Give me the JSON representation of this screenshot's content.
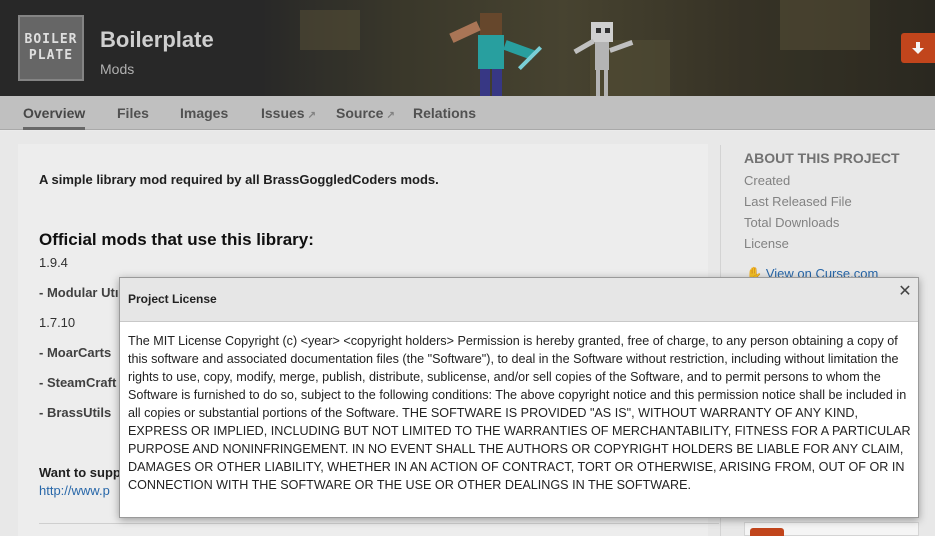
{
  "project": {
    "logo_line1": "BOILER",
    "logo_line2": "PLATE",
    "title": "Boilerplate",
    "category": "Mods"
  },
  "tabs": [
    {
      "label": "Overview",
      "active": true
    },
    {
      "label": "Files"
    },
    {
      "label": "Images"
    },
    {
      "label": "Issues",
      "external": true
    },
    {
      "label": "Source",
      "external": true
    },
    {
      "label": "Relations"
    }
  ],
  "icons": {
    "download": "download-arrow-icon",
    "external": "external-link-icon",
    "close": "close-icon"
  },
  "overview": {
    "lead": "A simple library mod required by all BrassGoggledCoders mods.",
    "mods_heading": "Official mods that use this library:",
    "version_1": "1.9.4",
    "mod_1": "- Modular Utı",
    "version_2": "1.7.10",
    "mod_2": "- MoarCarts",
    "mod_3": "- SteamCraft",
    "mod_4": "- BrassUtils",
    "support_text": "Want to supp",
    "support_link": "http://www.p"
  },
  "sidebar": {
    "heading": "ABOUT THIS PROJECT",
    "created": "Created",
    "last_released": "Last Released File",
    "total_downloads": "Total Downloads",
    "license": "License",
    "curse_link": "View on Curse.com"
  },
  "modal": {
    "title": "Project License",
    "close_glyph": "✕",
    "body": "The MIT License Copyright (c) <year> <copyright holders> Permission is hereby granted, free of charge, to any person obtaining a copy of this software and associated documentation files (the \"Software\"), to deal in the Software without restriction, including without limitation the rights to use, copy, modify, merge, publish, distribute, sublicense, and/or sell copies of the Software, and to permit persons to whom the Software is furnished to do so, subject to the following conditions: The above copyright notice and this permission notice shall be included in all copies or substantial portions of the Software. THE SOFTWARE IS PROVIDED \"AS IS\", WITHOUT WARRANTY OF ANY KIND, EXPRESS OR IMPLIED, INCLUDING BUT NOT LIMITED TO THE WARRANTIES OF MERCHANTABILITY, FITNESS FOR A PARTICULAR PURPOSE AND NONINFRINGEMENT. IN NO EVENT SHALL THE AUTHORS OR COPYRIGHT HOLDERS BE LIABLE FOR ANY CLAIM, DAMAGES OR OTHER LIABILITY, WHETHER IN AN ACTION OF CONTRACT, TORT OR OTHERWISE, ARISING FROM, OUT OF OR IN CONNECTION WITH THE SOFTWARE OR THE USE OR OTHER DEALINGS IN THE SOFTWARE."
  },
  "colors": {
    "accent": "#c9481e",
    "link": "#2a6cb0",
    "header_bg": "#2a2a2a"
  }
}
